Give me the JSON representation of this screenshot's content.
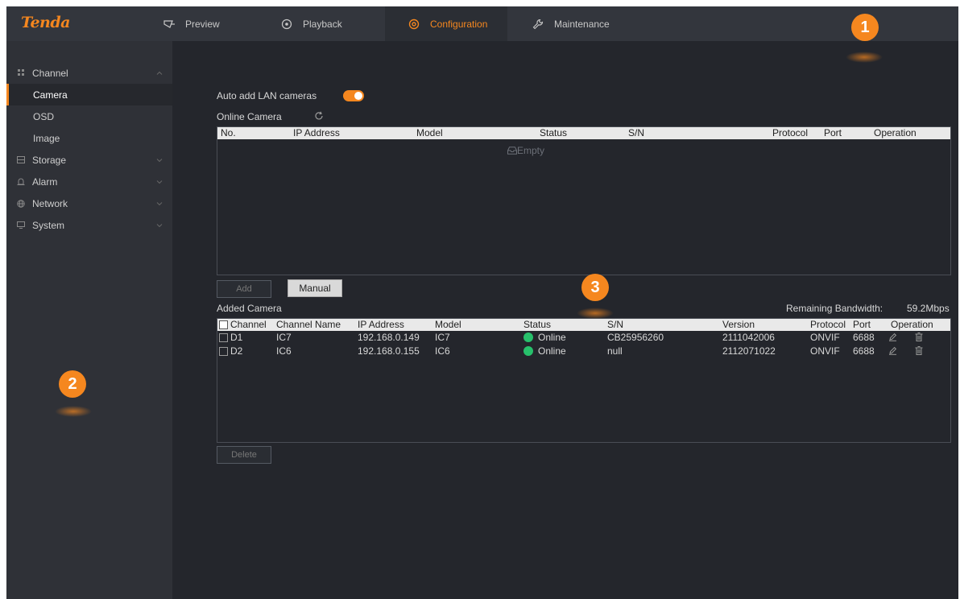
{
  "header": {
    "logo": "Tenda",
    "nav": [
      {
        "label": "Preview",
        "icon": "preview-icon"
      },
      {
        "label": "Playback",
        "icon": "playback-icon"
      },
      {
        "label": "Configuration",
        "icon": "configuration-icon",
        "active": true
      },
      {
        "label": "Maintenance",
        "icon": "maintenance-icon"
      }
    ]
  },
  "sidebar": {
    "groups": [
      {
        "label": "Channel",
        "icon": "channel-icon",
        "expanded": true,
        "children": [
          {
            "label": "Camera",
            "active": true
          },
          {
            "label": "OSD"
          },
          {
            "label": "Image"
          }
        ]
      },
      {
        "label": "Storage",
        "icon": "storage-icon"
      },
      {
        "label": "Alarm",
        "icon": "alarm-icon"
      },
      {
        "label": "Network",
        "icon": "network-icon"
      },
      {
        "label": "System",
        "icon": "system-icon"
      }
    ]
  },
  "main": {
    "auto_add_label": "Auto add LAN cameras",
    "auto_add_enabled": true,
    "online_camera_title": "Online Camera",
    "online_table": {
      "columns": [
        "No.",
        "IP Address",
        "Model",
        "Status",
        "S/N",
        "Protocol",
        "Port",
        "Operation"
      ],
      "empty_text": "Empty"
    },
    "add_button": "Add",
    "manual_button": "Manual",
    "added_camera_title": "Added Camera",
    "remaining_bandwidth_label": "Remaining Bandwidth:",
    "remaining_bandwidth_value": "59.2Mbps",
    "added_table": {
      "columns": [
        "Channel",
        "Channel Name",
        "IP Address",
        "Model",
        "Status",
        "S/N",
        "Version",
        "Protocol",
        "Port",
        "Operation"
      ],
      "rows": [
        {
          "channel": "D1",
          "name": "IC7",
          "ip": "192.168.0.149",
          "model": "IC7",
          "status": "Online",
          "sn": "CB25956260",
          "version": "2111042006",
          "protocol": "ONVIF",
          "port": "6688"
        },
        {
          "channel": "D2",
          "name": "IC6",
          "ip": "192.168.0.155",
          "model": "IC6",
          "status": "Online",
          "sn": "null",
          "version": "2112071022",
          "protocol": "ONVIF",
          "port": "6688"
        }
      ]
    },
    "delete_button": "Delete"
  },
  "callouts": [
    "1",
    "2",
    "3"
  ],
  "colors": {
    "accent": "#f5871f",
    "online": "#27c06b",
    "background": "#24262c",
    "sidebar": "#2f3137",
    "topbar": "#33363d"
  }
}
